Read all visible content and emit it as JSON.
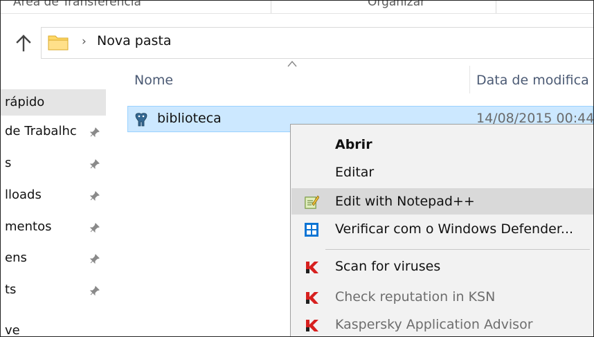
{
  "ribbon": {
    "groups": [
      "Área de Transferência",
      "Organizar"
    ]
  },
  "address_bar": {
    "up_icon": "up-arrow-icon",
    "folder_icon": "folder-icon",
    "separator": "›",
    "path": "Nova pasta"
  },
  "navigation": {
    "items": [
      {
        "label": "rápido",
        "pinned": false,
        "selected": true
      },
      {
        "label": "de Trabalhc",
        "pinned": true
      },
      {
        "label": "s",
        "pinned": true
      },
      {
        "label": "lloads",
        "pinned": true
      },
      {
        "label": "mentos",
        "pinned": true
      },
      {
        "label": "ens",
        "pinned": true
      },
      {
        "label": "ts",
        "pinned": true
      },
      {
        "label": "ve",
        "pinned": false
      }
    ]
  },
  "file_list": {
    "columns": {
      "name": "Nome",
      "date": "Data de modifica"
    },
    "rows": [
      {
        "name": "biblioteca",
        "date": "14/08/2015 00:44",
        "icon": "postgresql-elephant-icon"
      }
    ]
  },
  "context_menu": {
    "items": [
      {
        "label": "Abrir",
        "bold": true
      },
      {
        "label": "Editar"
      },
      {
        "label": "Edit with Notepad++",
        "icon": "notepad-plus-plus-icon",
        "highlighted": true
      },
      {
        "label": "Verificar com o Windows Defender...",
        "icon": "windows-defender-icon"
      },
      {
        "label": "Scan for viruses",
        "icon": "kaspersky-icon"
      },
      {
        "label": "Check reputation in KSN",
        "icon": "kaspersky-icon",
        "dimmed": true
      },
      {
        "label": "Kaspersky Application Advisor",
        "icon": "kaspersky-icon",
        "dimmed": true
      }
    ]
  },
  "colors": {
    "selection_fill": "#cce8ff",
    "selection_border": "#99d1ff",
    "header_text": "#4b5a74",
    "menu_background": "#f2f2f2",
    "menu_highlight": "#d9d9d9",
    "kaspersky_red": "#d7201f",
    "defender_blue": "#0b74d4",
    "folder_yellow": "#ffd866"
  }
}
